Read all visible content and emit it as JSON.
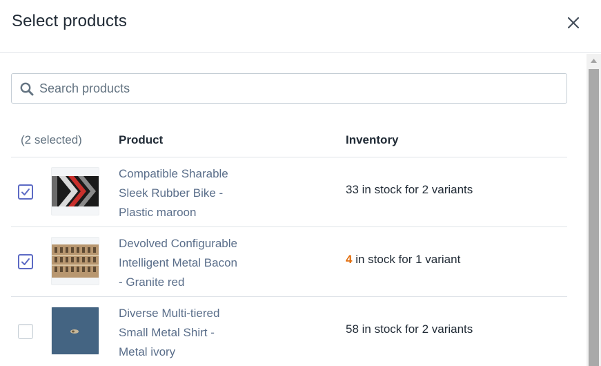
{
  "modal": {
    "title": "Select products",
    "close_icon": "close-icon"
  },
  "search": {
    "placeholder": "Search products",
    "value": "",
    "icon": "search-icon"
  },
  "table": {
    "selected_label": "(2 selected)",
    "col_product": "Product",
    "col_inventory": "Inventory",
    "rows": [
      {
        "checked": true,
        "name_lines": [
          "Compatible Sharable",
          "Sleek Rubber Bike -",
          "Plastic maroon"
        ],
        "inventory_count": "33",
        "inventory_rest": " in stock for 2 variants",
        "low_stock": false
      },
      {
        "checked": true,
        "name_lines": [
          "Devolved Configurable",
          "Intelligent Metal Bacon",
          "- Granite red"
        ],
        "inventory_count": "4",
        "inventory_rest": " in stock for 1 variant",
        "low_stock": true
      },
      {
        "checked": false,
        "name_lines": [
          "Diverse Multi-tiered",
          "Small Metal Shirt -",
          "Metal ivory"
        ],
        "inventory_count": "58",
        "inventory_rest": " in stock for 2 variants",
        "low_stock": false
      }
    ]
  },
  "colors": {
    "accent": "#5c6ac4",
    "low_stock": "#e26d0c",
    "link": "#5a6e8a"
  }
}
